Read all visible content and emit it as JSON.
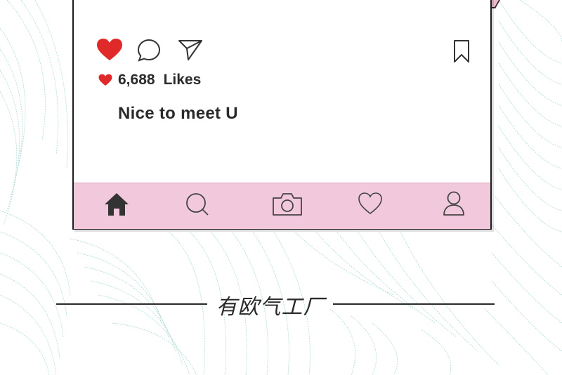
{
  "post": {
    "likes_count": "6,688",
    "likes_label": "Likes",
    "caption": "Nice to meet U"
  },
  "icons": {
    "action_bar": [
      "heart-icon",
      "comment-icon",
      "share-icon",
      "bookmark-icon"
    ],
    "likes_row": [
      "heart-icon"
    ],
    "tab_bar": [
      "home-icon",
      "search-icon",
      "camera-icon",
      "heart-outline-icon",
      "profile-icon"
    ]
  },
  "brand": {
    "text": "有欧气工厂"
  },
  "colors": {
    "like_red": "#e02929",
    "tab_bar_pink": "#f2c9dc",
    "background_pattern": "#9fcfcf",
    "icon_dark": "#333333"
  }
}
